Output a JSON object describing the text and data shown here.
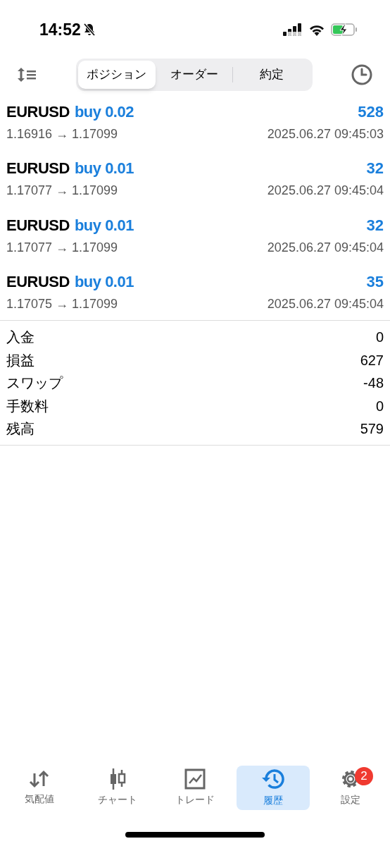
{
  "status_bar": {
    "time": "14:52"
  },
  "tabs": [
    {
      "label": "ポジション",
      "selected": true
    },
    {
      "label": "オーダー",
      "selected": false
    },
    {
      "label": "約定",
      "selected": false
    }
  ],
  "trades": [
    {
      "symbol": "EURUSD",
      "order": "buy 0.02",
      "profit": "528",
      "prices": "1.16916 → 1.17099",
      "time": "2025.06.27 09:45:03"
    },
    {
      "symbol": "EURUSD",
      "order": "buy 0.01",
      "profit": "32",
      "prices": "1.17077 → 1.17099",
      "time": "2025.06.27 09:45:04"
    },
    {
      "symbol": "EURUSD",
      "order": "buy 0.01",
      "profit": "32",
      "prices": "1.17077 → 1.17099",
      "time": "2025.06.27 09:45:04"
    },
    {
      "symbol": "EURUSD",
      "order": "buy 0.01",
      "profit": "35",
      "prices": "1.17075 → 1.17099",
      "time": "2025.06.27 09:45:04"
    }
  ],
  "summary": [
    {
      "label": "入金",
      "value": "0"
    },
    {
      "label": "損益",
      "value": "627"
    },
    {
      "label": "スワップ",
      "value": "-48"
    },
    {
      "label": "手数料",
      "value": "0"
    },
    {
      "label": "残高",
      "value": "579"
    }
  ],
  "nav": [
    {
      "kind": "quotes",
      "label": "気配値",
      "selected": false
    },
    {
      "kind": "chart",
      "label": "チャート",
      "selected": false
    },
    {
      "kind": "trade",
      "label": "トレード",
      "selected": false
    },
    {
      "kind": "history",
      "label": "履歴",
      "selected": true
    },
    {
      "kind": "settings",
      "label": "設定",
      "selected": false,
      "badge": "2"
    }
  ]
}
